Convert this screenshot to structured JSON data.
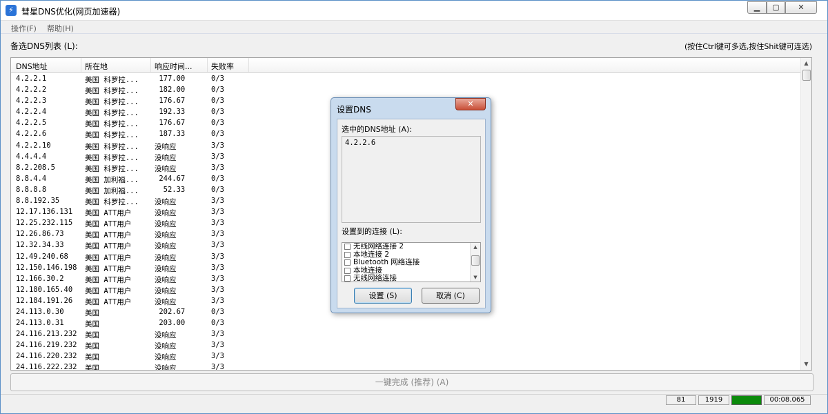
{
  "window": {
    "title": "彗星DNS优化(网页加速器)",
    "icon": "lightning-icon"
  },
  "menu": [
    {
      "label": "操作(F)"
    },
    {
      "label": "帮助(H)"
    }
  ],
  "list": {
    "label": "备选DNS列表 (L):",
    "hint": "(按住Ctrl键可多选,按住Shit键可连选)",
    "columns": [
      "DNS地址",
      "所在地",
      "响应时间...",
      "失败率"
    ],
    "rows": [
      [
        "4.2.2.1",
        "美国 科罗拉...",
        " 177.00",
        "0/3"
      ],
      [
        "4.2.2.2",
        "美国 科罗拉...",
        " 182.00",
        "0/3"
      ],
      [
        "4.2.2.3",
        "美国 科罗拉...",
        " 176.67",
        "0/3"
      ],
      [
        "4.2.2.4",
        "美国 科罗拉...",
        " 192.33",
        "0/3"
      ],
      [
        "4.2.2.5",
        "美国 科罗拉...",
        " 176.67",
        "0/3"
      ],
      [
        "4.2.2.6",
        "美国 科罗拉...",
        " 187.33",
        "0/3"
      ],
      [
        "4.2.2.10",
        "美国 科罗拉...",
        "没响应",
        "3/3"
      ],
      [
        "4.4.4.4",
        "美国 科罗拉...",
        "没响应",
        "3/3"
      ],
      [
        "8.2.208.5",
        "美国 科罗拉...",
        "没响应",
        "3/3"
      ],
      [
        "8.8.4.4",
        "美国 加利福...",
        " 244.67",
        "0/3"
      ],
      [
        "8.8.8.8",
        "美国 加利福...",
        "  52.33",
        "0/3"
      ],
      [
        "8.8.192.35",
        "美国 科罗拉...",
        "没响应",
        "3/3"
      ],
      [
        "12.17.136.131",
        "美国 ATT用户",
        "没响应",
        "3/3"
      ],
      [
        "12.25.232.115",
        "美国 ATT用户",
        "没响应",
        "3/3"
      ],
      [
        "12.26.86.73",
        "美国 ATT用户",
        "没响应",
        "3/3"
      ],
      [
        "12.32.34.33",
        "美国 ATT用户",
        "没响应",
        "3/3"
      ],
      [
        "12.49.240.68",
        "美国 ATT用户",
        "没响应",
        "3/3"
      ],
      [
        "12.150.146.198",
        "美国 ATT用户",
        "没响应",
        "3/3"
      ],
      [
        "12.166.30.2",
        "美国 ATT用户",
        "没响应",
        "3/3"
      ],
      [
        "12.180.165.40",
        "美国 ATT用户",
        "没响应",
        "3/3"
      ],
      [
        "12.184.191.26",
        "美国 ATT用户",
        "没响应",
        "3/3"
      ],
      [
        "24.113.0.30",
        "美国",
        " 202.67",
        "0/3"
      ],
      [
        "24.113.0.31",
        "美国",
        " 203.00",
        "0/3"
      ],
      [
        "24.116.213.232",
        "美国",
        "没响应",
        "3/3"
      ],
      [
        "24.116.219.232",
        "美国",
        "没响应",
        "3/3"
      ],
      [
        "24.116.220.232",
        "美国",
        "没响应",
        "3/3"
      ],
      [
        "24.116.222.232",
        "美国",
        "没响应",
        "3/3"
      ]
    ]
  },
  "action_button": "一键完成 (推荐) (A)",
  "status": {
    "count1": "81",
    "count2": "1919",
    "progress_color": "#0b8a0b",
    "elapsed": "00:08.065"
  },
  "dialog": {
    "title": "设置DNS",
    "close_icon": "close-icon",
    "selected_label": "选中的DNS地址 (A):",
    "selected_value": "4.2.2.6",
    "connections_label": "设置到的连接 (L):",
    "connections": [
      "无线网络连接 2",
      "本地连接 2",
      "Bluetooth 网络连接",
      "本地连接",
      "无线网络连接"
    ],
    "ok_label": "设置 (S)",
    "cancel_label": "取消 (C)"
  }
}
